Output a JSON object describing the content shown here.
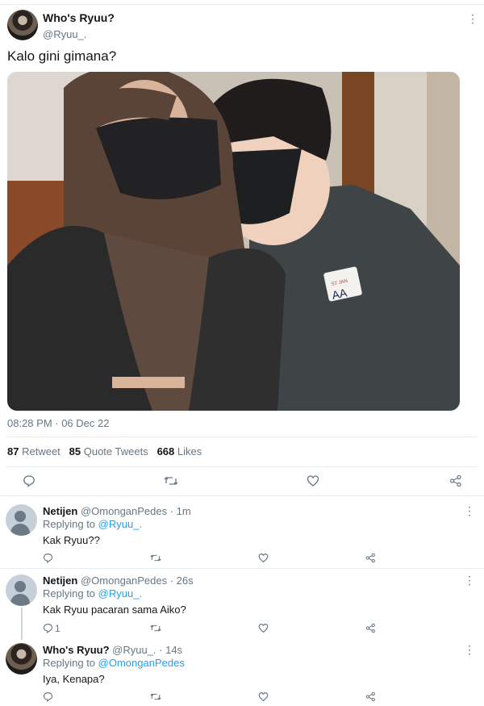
{
  "tweet": {
    "author_name": "Who's Ryuu?",
    "author_handle": "@Ryuu_.",
    "text": "Kalo gini gimana?",
    "timestamp": "08:28 PM · 06 Dec 22",
    "badge_line1": "ST JAN",
    "badge_line2": "AA",
    "stats": {
      "retweets": "87",
      "retweets_label": "Retweet",
      "quotes": "85",
      "quotes_label": "Quote Tweets",
      "likes": "668",
      "likes_label": "Likes"
    },
    "more_icon": "⋮"
  },
  "replies": [
    {
      "name": "Netijen",
      "meta": "@OmonganPedes · 1m",
      "replying_label": "Replying to",
      "replying_to": "@Ryuu_.",
      "text": "Kak Ryuu??",
      "reply_count": ""
    },
    {
      "name": "Netijen",
      "meta": "@OmonganPedes · 26s",
      "replying_label": "Replying to",
      "replying_to": "@Ryuu_.",
      "text": "Kak Ryuu pacaran sama Aiko?",
      "reply_count": "1"
    },
    {
      "name": "Who's Ryuu?",
      "meta": "@Ryuu_. · 14s",
      "replying_label": "Replying to",
      "replying_to": "@OmonganPedes",
      "text": "Iya, Kenapa?",
      "reply_count": ""
    }
  ],
  "colors": {
    "link": "#1da1f2",
    "secondary": "#657786",
    "divider": "#e6ecf0"
  }
}
